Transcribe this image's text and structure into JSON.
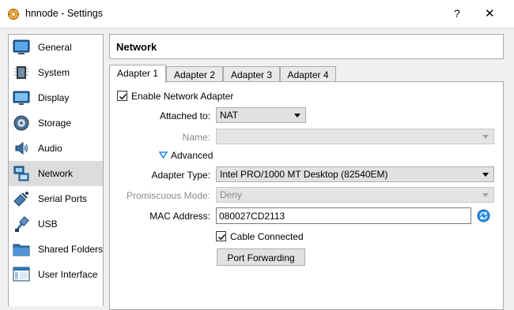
{
  "window": {
    "title": "hnnode - Settings",
    "help": "?",
    "close": "✕"
  },
  "sidebar": {
    "items": [
      {
        "label": "General",
        "icon": "general-icon"
      },
      {
        "label": "System",
        "icon": "system-icon"
      },
      {
        "label": "Display",
        "icon": "display-icon"
      },
      {
        "label": "Storage",
        "icon": "storage-icon"
      },
      {
        "label": "Audio",
        "icon": "audio-icon"
      },
      {
        "label": "Network",
        "icon": "network-icon",
        "selected": true
      },
      {
        "label": "Serial Ports",
        "icon": "serial-ports-icon"
      },
      {
        "label": "USB",
        "icon": "usb-icon"
      },
      {
        "label": "Shared Folders",
        "icon": "shared-folders-icon"
      },
      {
        "label": "User Interface",
        "icon": "user-interface-icon"
      }
    ]
  },
  "header": {
    "title": "Network"
  },
  "tabs": [
    {
      "label": "Adapter 1",
      "active": true
    },
    {
      "label": "Adapter 2"
    },
    {
      "label": "Adapter 3"
    },
    {
      "label": "Adapter 4"
    }
  ],
  "adapter": {
    "enable_label": "Enable Network Adapter",
    "enable_checked": true,
    "attached_label": "Attached to:",
    "attached_value": "NAT",
    "name_label": "Name:",
    "name_value": "",
    "advanced_label": "Advanced",
    "adapter_type_label": "Adapter Type:",
    "adapter_type_value": "Intel PRO/1000 MT Desktop (82540EM)",
    "promiscuous_label": "Promiscuous Mode:",
    "promiscuous_value": "Deny",
    "mac_label": "MAC Address:",
    "mac_value": "080027CD2113",
    "cable_label": "Cable Connected",
    "cable_checked": true,
    "port_forwarding_label": "Port Forwarding"
  },
  "colors": {
    "accent": "#1e88e5",
    "selected_bg": "#dcdcdc"
  }
}
